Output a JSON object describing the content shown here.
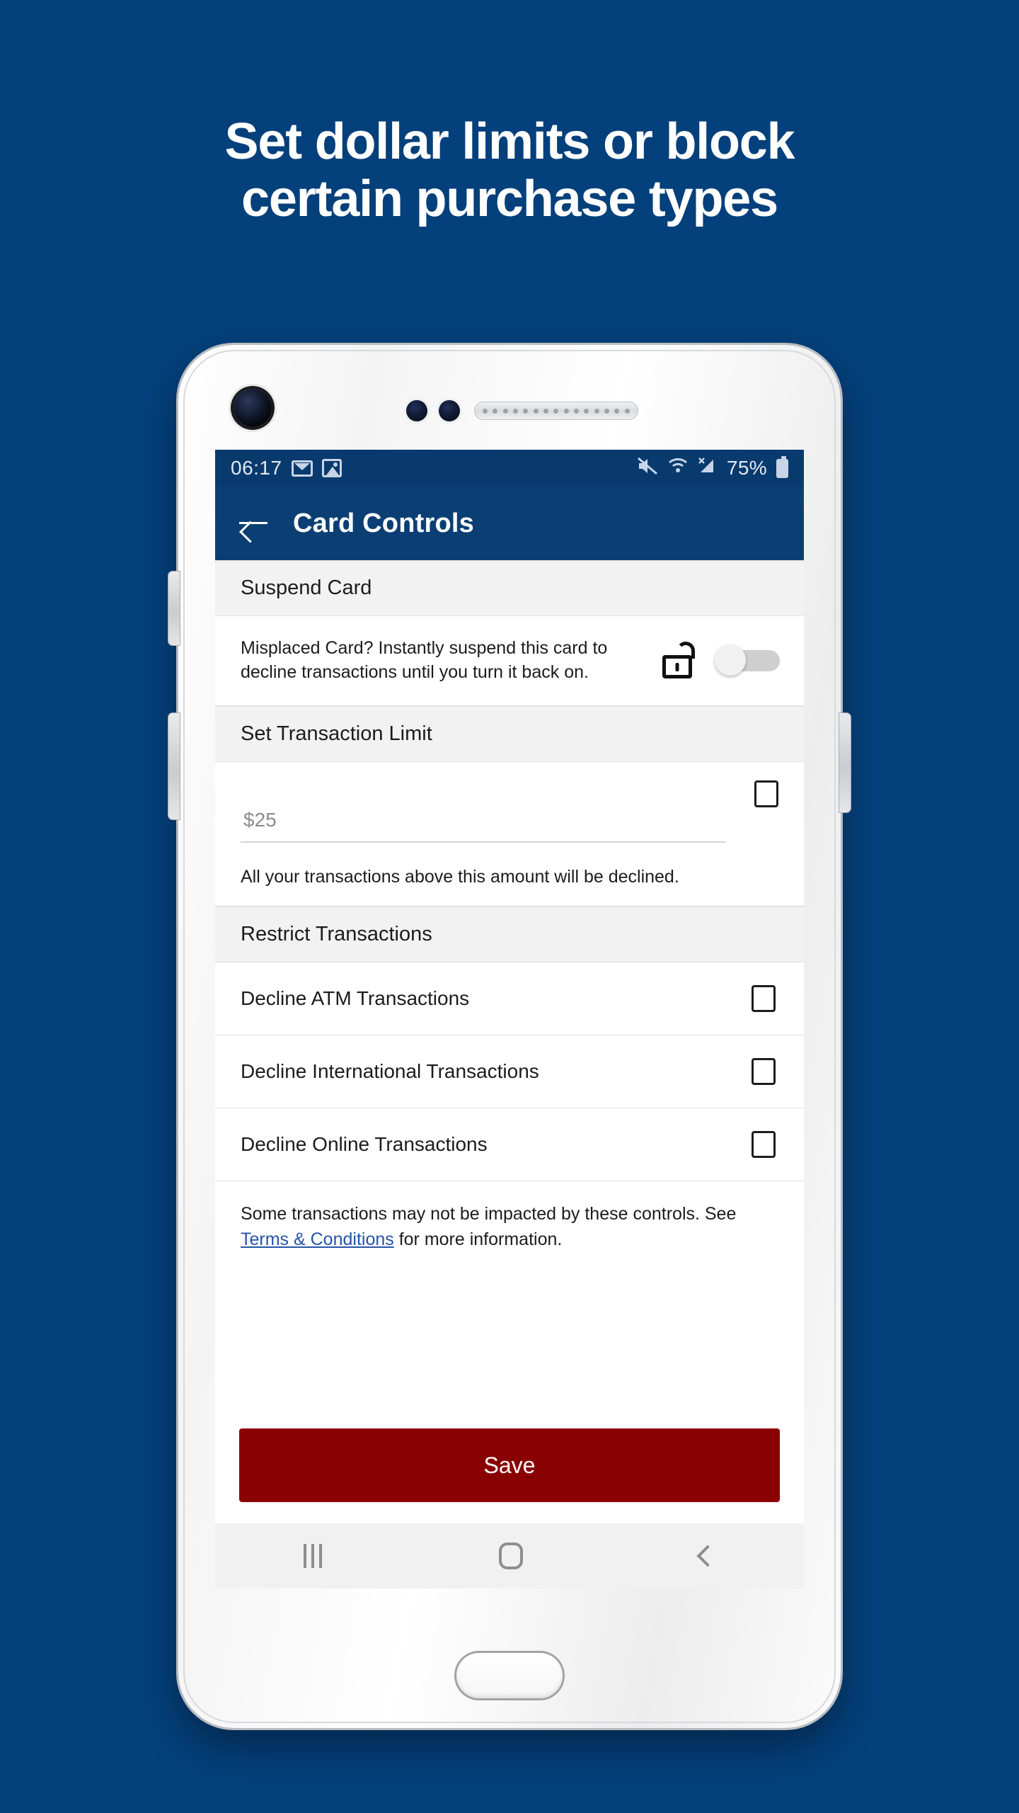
{
  "page": {
    "background_color": "#04407B",
    "headline_lines": [
      "Set dollar limits or block",
      "certain purchase types"
    ]
  },
  "phone": {
    "status_bar": {
      "time": "06:17",
      "left_icons": [
        "gmail-icon",
        "photo-icon"
      ],
      "right_icons": [
        "mute-icon",
        "wifi-icon",
        "signal-icon"
      ],
      "battery_percent": "75%",
      "background_color": "#093A6E"
    },
    "app_bar": {
      "back_icon": "back-arrow-icon",
      "title": "Card Controls",
      "background_color": "#0B3F74"
    },
    "nav_bar": {
      "recent_label": "recent-apps-icon",
      "home_label": "home-icon",
      "back_label": "back-icon"
    }
  },
  "screen": {
    "suspend_section": {
      "header": "Suspend Card",
      "description": "Misplaced Card? Instantly suspend this card to decline transactions until you turn it back on.",
      "lock_icon": "unlocked-padlock-icon",
      "toggle_state": "off"
    },
    "limit_section": {
      "header": "Set Transaction Limit",
      "amount_value": "",
      "amount_placeholder": "$25",
      "checkbox_checked": false,
      "note": "All your transactions above this amount will be declined."
    },
    "restrict_section": {
      "header": "Restrict Transactions",
      "rows": [
        {
          "label": "Decline ATM Transactions",
          "checked": false
        },
        {
          "label": "Decline International Transactions",
          "checked": false
        },
        {
          "label": "Decline Online Transactions",
          "checked": false
        }
      ]
    },
    "terms": {
      "text_before": "Some transactions may not be impacted by these controls. See ",
      "link_text": "Terms & Conditions",
      "text_after": " for more information."
    },
    "save": {
      "label": "Save",
      "color": "#8A0103"
    }
  }
}
